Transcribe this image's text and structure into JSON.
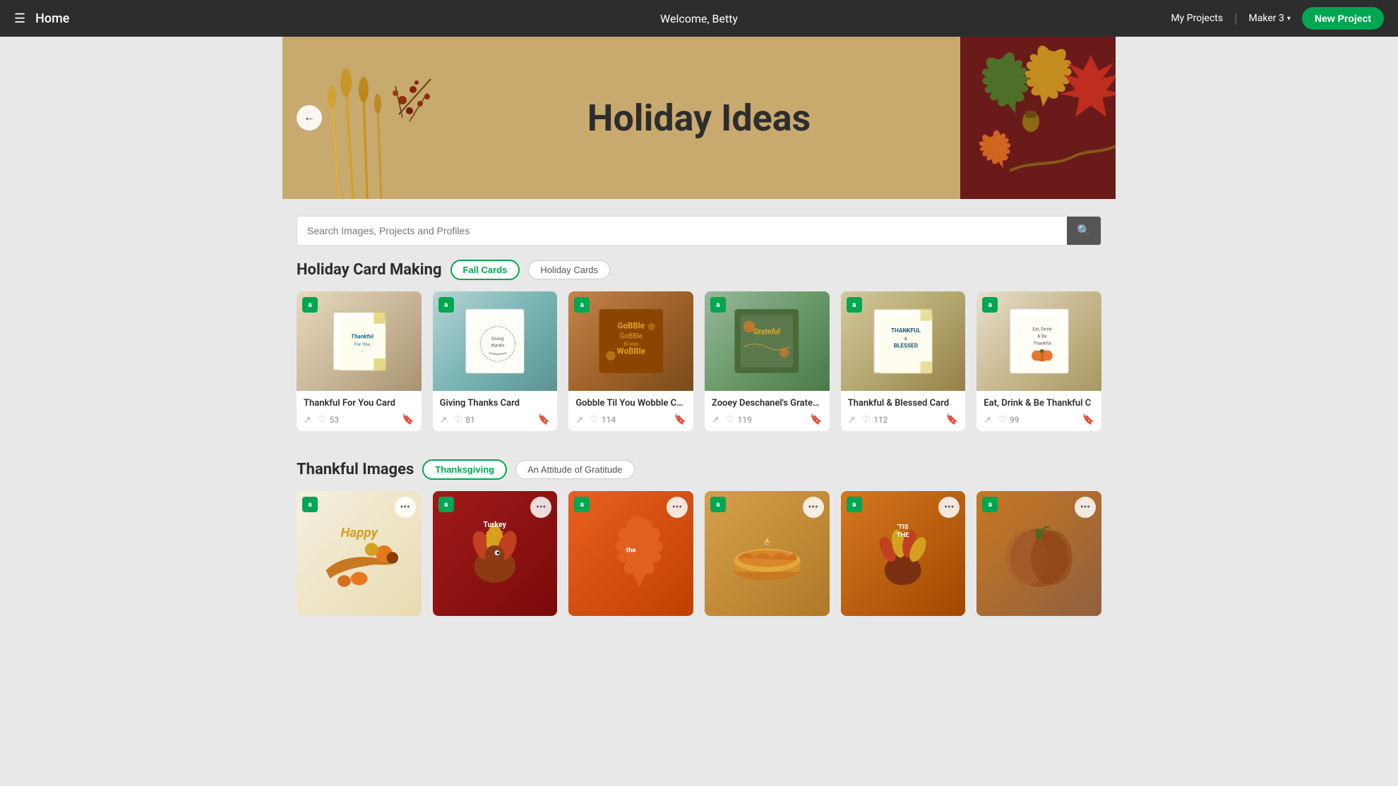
{
  "header": {
    "menu_label": "☰",
    "title": "Home",
    "welcome_text": "Welcome, Betty",
    "my_projects_label": "My Projects",
    "maker_label": "Maker 3",
    "new_project_label": "New Project"
  },
  "hero": {
    "title": "Holiday Ideas",
    "back_icon": "←"
  },
  "search": {
    "placeholder": "Search Images, Projects and Profiles",
    "search_icon": "🔍"
  },
  "holiday_card_section": {
    "title": "Holiday Card Making",
    "tags": [
      {
        "label": "Fall Cards",
        "active": true
      },
      {
        "label": "Holiday Cards",
        "active": false
      }
    ],
    "cards": [
      {
        "id": 1,
        "name": "Thankful For You Card",
        "likes": 53,
        "has_badge": true
      },
      {
        "id": 2,
        "name": "Giving Thanks Card",
        "likes": 81,
        "has_badge": true
      },
      {
        "id": 3,
        "name": "Gobble Til You Wobble Card",
        "likes": 114,
        "has_badge": true
      },
      {
        "id": 4,
        "name": "Zooey Deschanel's Grateful ...",
        "likes": 119,
        "has_badge": true
      },
      {
        "id": 5,
        "name": "Thankful & Blessed Card",
        "likes": 112,
        "has_badge": true
      },
      {
        "id": 6,
        "name": "Eat, Drink & Be Thankful C",
        "likes": 99,
        "has_badge": true
      }
    ]
  },
  "thankful_images_section": {
    "title": "Thankful Images",
    "tags": [
      {
        "label": "Thanksgiving",
        "active": true
      },
      {
        "label": "An Attitude of Gratitude",
        "active": false
      }
    ],
    "images": [
      {
        "id": 1,
        "has_badge": true
      },
      {
        "id": 2,
        "has_badge": true
      },
      {
        "id": 3,
        "has_badge": true
      },
      {
        "id": 4,
        "has_badge": true
      },
      {
        "id": 5,
        "has_badge": true
      },
      {
        "id": 6,
        "has_badge": true
      }
    ]
  },
  "icons": {
    "hamburger": "☰",
    "chevron_down": "▾",
    "back_arrow": "←",
    "search": "⌕",
    "share": "↗",
    "heart": "♡",
    "bookmark": "🔖",
    "badge_a": "a",
    "more_dots": "•••"
  }
}
